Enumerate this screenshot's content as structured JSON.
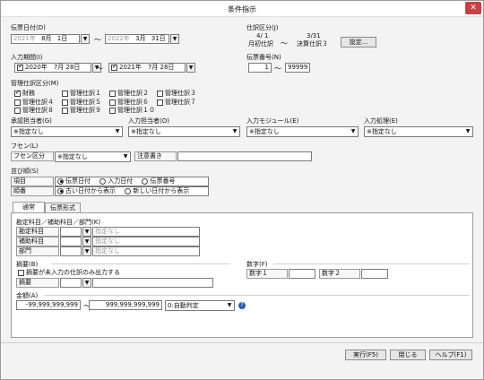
{
  "window": {
    "title": "条件指示",
    "close": "✕"
  },
  "slip_date": {
    "label": "伝票日付(D)",
    "from_year": "2021年",
    "from_month": "8月",
    "from_day": "1日",
    "tilde": "〜",
    "to_year": "2022年",
    "to_month": "3月",
    "to_day": "31日"
  },
  "journal_class": {
    "label": "仕訳区分(J)",
    "from_date": "4/ 1",
    "from_name": "月初仕訳",
    "tilde": "〜",
    "to_date": "3/31",
    "to_name": "決算仕訳３",
    "settings_button": "設定..."
  },
  "input_period": {
    "label": "入力期間(I)",
    "from_date": "2020年　7月 28日",
    "to_date": "2021年　7月 28日",
    "tilde": "〜"
  },
  "slip_number": {
    "label": "伝票番号(N)",
    "from": "1",
    "tilde": "〜",
    "to": "99999"
  },
  "mgmt_class": {
    "label": "管理仕訳区分(M)",
    "items": [
      {
        "label": "財務",
        "checked": true
      },
      {
        "label": "管理仕訳１",
        "checked": false
      },
      {
        "label": "管理仕訳２",
        "checked": false
      },
      {
        "label": "管理仕訳３",
        "checked": false
      },
      {
        "label": "管理仕訳４",
        "checked": false
      },
      {
        "label": "管理仕訳５",
        "checked": false
      },
      {
        "label": "管理仕訳６",
        "checked": false
      },
      {
        "label": "管理仕訳７",
        "checked": false
      },
      {
        "label": "管理仕訳８",
        "checked": false
      },
      {
        "label": "管理仕訳９",
        "checked": false
      },
      {
        "label": "管理仕訳１０",
        "checked": false
      }
    ]
  },
  "filters": [
    {
      "label": "承認担当者(G)",
      "value": "※指定なし"
    },
    {
      "label": "入力担当者(O)",
      "value": "※指定なし"
    },
    {
      "label": "入力モジュール(E)",
      "value": "※指定なし"
    },
    {
      "label": "入力処理(E)",
      "value": "※指定なし"
    }
  ],
  "fusen": {
    "label": "フセン(L)",
    "class_label": "フセン区分",
    "class_value": "※指定なし",
    "note_label": "注意書き",
    "note_value": ""
  },
  "sort": {
    "label": "並び順(S)",
    "item_label": "項目",
    "item_options": [
      {
        "label": "伝票日付",
        "selected": true
      },
      {
        "label": "入力日付",
        "selected": false
      },
      {
        "label": "伝票番号",
        "selected": false
      }
    ],
    "order_label": "順番",
    "order_options": [
      {
        "label": "古い日付から表示",
        "selected": true
      },
      {
        "label": "新しい日付から表示",
        "selected": false
      }
    ]
  },
  "tabs": [
    {
      "label": "通常",
      "active": true
    },
    {
      "label": "伝票形式",
      "active": false
    }
  ],
  "accounts": {
    "label": "勘定科目／補助科目／部門(K)",
    "rows": [
      {
        "label": "勘定科目",
        "value": "",
        "placeholder": "指定なし"
      },
      {
        "label": "補助科目",
        "value": "",
        "placeholder": "指定なし"
      },
      {
        "label": "部門",
        "value": "",
        "placeholder": "指定なし"
      }
    ]
  },
  "summary": {
    "label": "摘要(B)",
    "unregistered_only": "摘要が未入力の仕訳のみ出力する",
    "summary_field_label": "摘要",
    "summary_value": ""
  },
  "numbers": {
    "label": "数字(F)",
    "num1_label": "数字１",
    "num1_value": "",
    "num2_label": "数字２",
    "num2_value": ""
  },
  "amount": {
    "label": "金額(A)",
    "from": "-99,999,999,999",
    "tilde": "〜",
    "to": "999,999,999,999",
    "mode": "0:自動判定",
    "help": "?"
  },
  "footer": {
    "run": "実行(F5)",
    "close": "閉じる",
    "help": "ヘルプ(F1)"
  }
}
